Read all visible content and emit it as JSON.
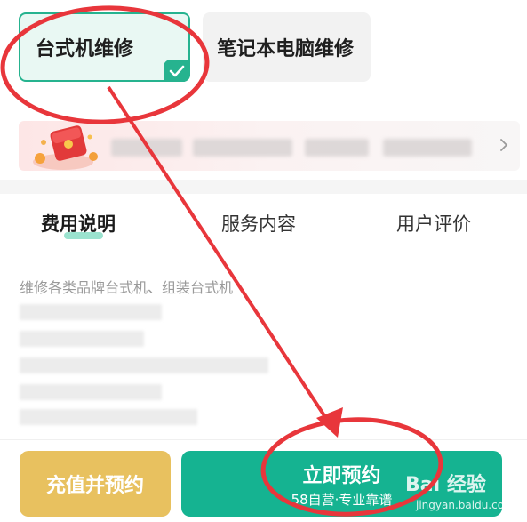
{
  "service_types": [
    {
      "label": "台式机维修",
      "selected": true
    },
    {
      "label": "笔记本电脑维修",
      "selected": false
    }
  ],
  "tabs": [
    {
      "label": "费用说明",
      "active": true
    },
    {
      "label": "服务内容",
      "active": false
    },
    {
      "label": "用户评价",
      "active": false
    }
  ],
  "content": {
    "description": "维修各类品牌台式机、组装台式机"
  },
  "actions": {
    "recharge_label": "充值并预约",
    "book_label": "立即预约",
    "book_sub": "58自营·专业靠谱"
  },
  "watermark": {
    "brand": "Bai 经验",
    "url": "jingyan.baidu.com"
  },
  "colors": {
    "accent": "#26b38f",
    "book_button": "#15b391",
    "recharge_button": "#e8c15f",
    "annotation": "#e8363b"
  },
  "icons": {
    "check": "check-icon",
    "promo": "red-envelope-icon",
    "chevron": "chevron-right-icon"
  }
}
